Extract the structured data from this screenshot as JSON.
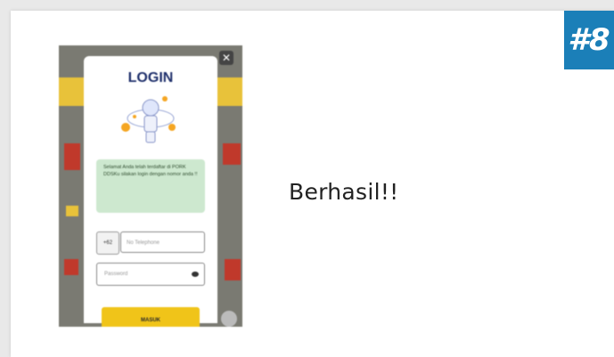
{
  "badge": {
    "text": "#8",
    "color": "#1b7fb8"
  },
  "caption": "Berhasil!!",
  "login": {
    "title": "LOGIN",
    "message": "Selamat Anda telah terdaftar di PORK DDSKu silakan login dengan nomor anda !!",
    "prefix": "+62",
    "phone_placeholder": "No Telephone",
    "password_placeholder": "Password",
    "submit_label": "MASUK"
  },
  "icons": {
    "close": "close-icon",
    "eye": "eye-icon",
    "help": "help-icon"
  },
  "colors": {
    "title": "#1e2f6b",
    "message_bg": "#cde8cf",
    "submit_bg": "#f0c419"
  }
}
